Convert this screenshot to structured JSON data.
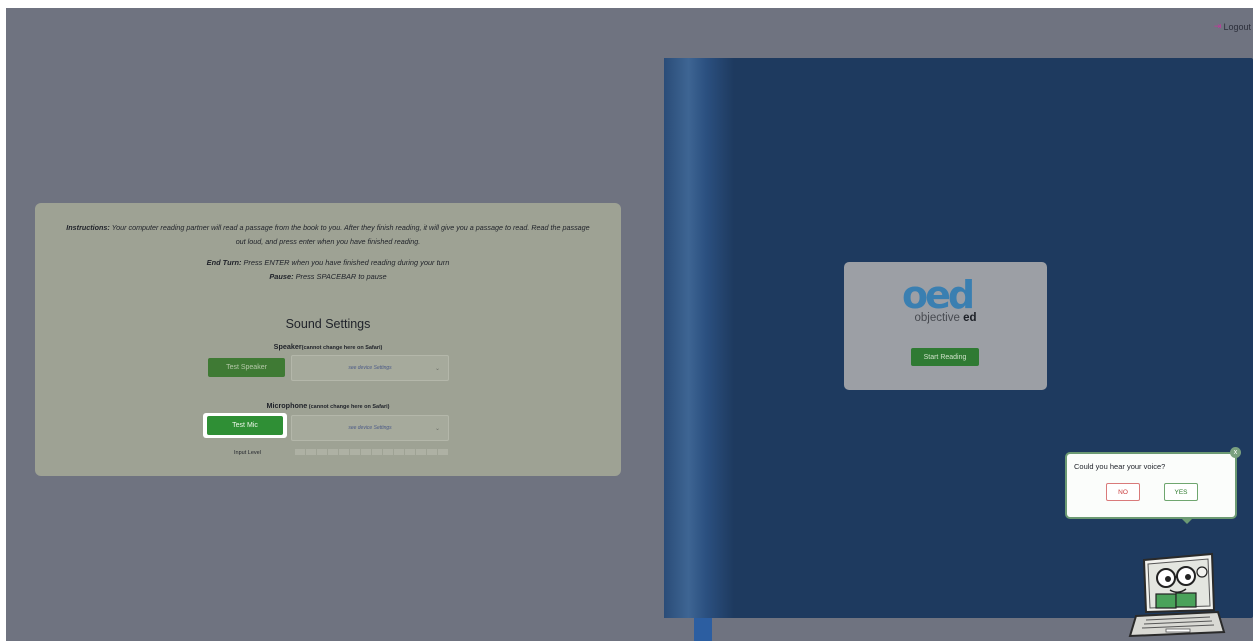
{
  "header": {
    "logout_label": "Logout"
  },
  "instructions": {
    "label": "Instructions:",
    "text": " Your computer reading partner will read a passage from the book to you. After they finish reading, it will give you a passage to read. Read the passage out loud, and press enter when you have finished reading.",
    "end_turn_label": "End Turn:",
    "end_turn_text": " Press ENTER when you have finished reading during your turn",
    "pause_label": "Pause:",
    "pause_text": " Press SPACEBAR to pause"
  },
  "sound_settings": {
    "title": "Sound Settings",
    "speaker_label": "Speaker",
    "speaker_note": "(cannot change here on Safari)",
    "test_speaker_label": "Test Speaker",
    "speaker_select_value": "see device Settings",
    "microphone_label": "Microphone",
    "microphone_note": " (cannot change here on Safari)",
    "test_mic_label": "Test Mic",
    "mic_select_value": "see device Settings",
    "input_level_label": "Input Level",
    "input_level_value": 0
  },
  "book": {
    "logo_mark": "oed",
    "logo_text_light": "objective ",
    "logo_text_bold": "ed",
    "start_reading_label": "Start Reading"
  },
  "popup": {
    "question": "Could you hear your voice?",
    "no_label": "NO",
    "yes_label": "YES",
    "close_label": "x"
  },
  "icons": [
    "logout-icon",
    "chevron-down-icon",
    "close-icon",
    "mascot-icon"
  ],
  "colors": {
    "primary_green": "#2f8f35",
    "book_blue": "#1e3a5f",
    "brand_blue": "#3a7fb1"
  }
}
